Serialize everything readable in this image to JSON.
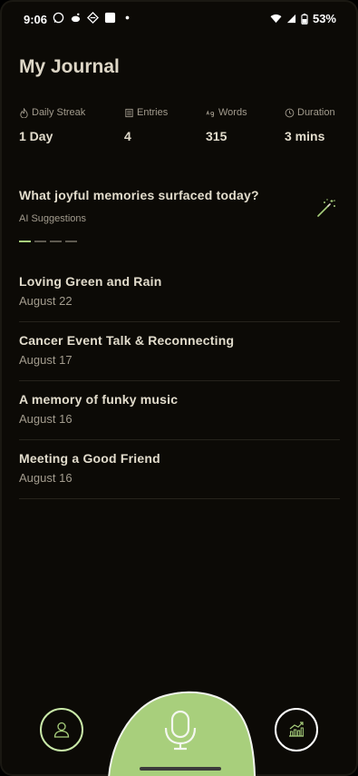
{
  "status_bar": {
    "time": "9:06",
    "battery": "53%"
  },
  "header": {
    "title": "My Journal"
  },
  "stats": [
    {
      "label": "Daily Streak",
      "value": "1 Day",
      "icon": "streak-icon"
    },
    {
      "label": "Entries",
      "value": "4",
      "icon": "entries-icon"
    },
    {
      "label": "Words",
      "value": "315",
      "icon": "words-icon"
    },
    {
      "label": "Duration",
      "value": "3 mins",
      "icon": "clock-icon"
    }
  ],
  "prompt": {
    "text": "What joyful memories surfaced today?",
    "sub": "AI Suggestions",
    "page_count": 4,
    "active_page": 1
  },
  "entries": [
    {
      "title": "Loving Green and Rain",
      "date": "August 22"
    },
    {
      "title": "Cancer Event Talk & Reconnecting",
      "date": "August 17"
    },
    {
      "title": "A memory of funky music",
      "date": "August 16"
    },
    {
      "title": "Meeting a Good Friend",
      "date": "August 16"
    }
  ],
  "colors": {
    "background": "#0c0a06",
    "accent": "#a8cf7c",
    "text": "#e2dccc",
    "muted": "#a39c8e"
  }
}
